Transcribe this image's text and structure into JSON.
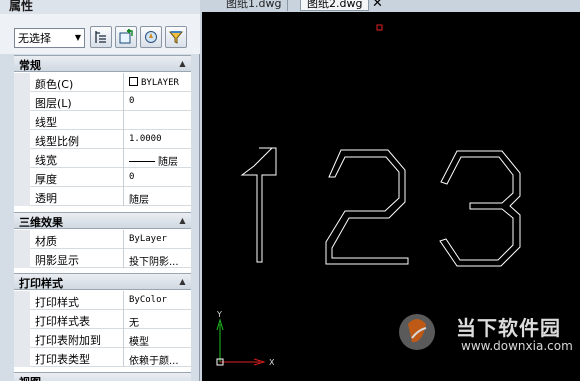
{
  "palette": {
    "title": "属性",
    "selector": "无选择",
    "toolbar_icons": [
      "pickadd-toggle-icon",
      "select-objects-icon",
      "quick-select-icon",
      "filter-icon"
    ]
  },
  "sections": {
    "general": {
      "title": "常规",
      "rows": [
        {
          "name": "颜色(C)",
          "value": "BYLAYER"
        },
        {
          "name": "图层(L)",
          "value": "0"
        },
        {
          "name": "线型",
          "value": ""
        },
        {
          "name": "线型比例",
          "value": "1.0000"
        },
        {
          "name": "线宽",
          "value": "随层"
        },
        {
          "name": "厚度",
          "value": "0"
        },
        {
          "name": "透明",
          "value": "随层"
        }
      ]
    },
    "three_d": {
      "title": "三维效果",
      "rows": [
        {
          "name": "材质",
          "value": "ByLayer"
        },
        {
          "name": "阴影显示",
          "value": "投下阴影..."
        }
      ]
    },
    "plot": {
      "title": "打印样式",
      "rows": [
        {
          "name": "打印样式",
          "value": "ByColor"
        },
        {
          "name": "打印样式表",
          "value": "无"
        },
        {
          "name": "打印表附加到",
          "value": "模型"
        },
        {
          "name": "打印表类型",
          "value": "依赖于颜..."
        }
      ]
    },
    "view": {
      "title": "视图"
    }
  },
  "tabs": [
    {
      "label": "图纸1.dwg",
      "active": false
    },
    {
      "label": "图纸2.dwg",
      "active": true
    }
  ],
  "canvas": {
    "ucs_x": "X",
    "ucs_y": "Y",
    "watermark_name": "当下软件园",
    "watermark_url": "www.downxia.com",
    "colors": {
      "background": "#000000",
      "linework": "#ffffff",
      "ucs_x_axis": "#e02020",
      "ucs_y_axis": "#20c020",
      "grip": "#e02020"
    }
  }
}
